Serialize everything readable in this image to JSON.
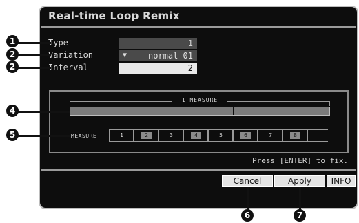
{
  "screen": {
    "title": "Real-time Loop Remix"
  },
  "params": [
    {
      "label": "Type",
      "value": "1"
    },
    {
      "label": "Variation",
      "value": "normal 01",
      "arrow": "▼"
    },
    {
      "label": "Interval",
      "value": "2"
    }
  ],
  "measure_display": {
    "range_label": "1 MEASURE",
    "row_label": "MEASURE",
    "cells": [
      "1",
      "2",
      "3",
      "4",
      "5",
      "6",
      "7",
      "8"
    ]
  },
  "hint": "Press [ENTER] to fix.",
  "buttons": {
    "cancel": "Cancel",
    "apply": "Apply",
    "info": "INFO"
  },
  "callouts": [
    "1",
    "2",
    "2",
    "4",
    "5",
    "6",
    "7"
  ],
  "colors": {
    "screen_bg": "#0d0d0d",
    "field_gray": "#4a4a4a",
    "field_active": "#e8e8e8",
    "button_bg": "#e4e4e4"
  }
}
